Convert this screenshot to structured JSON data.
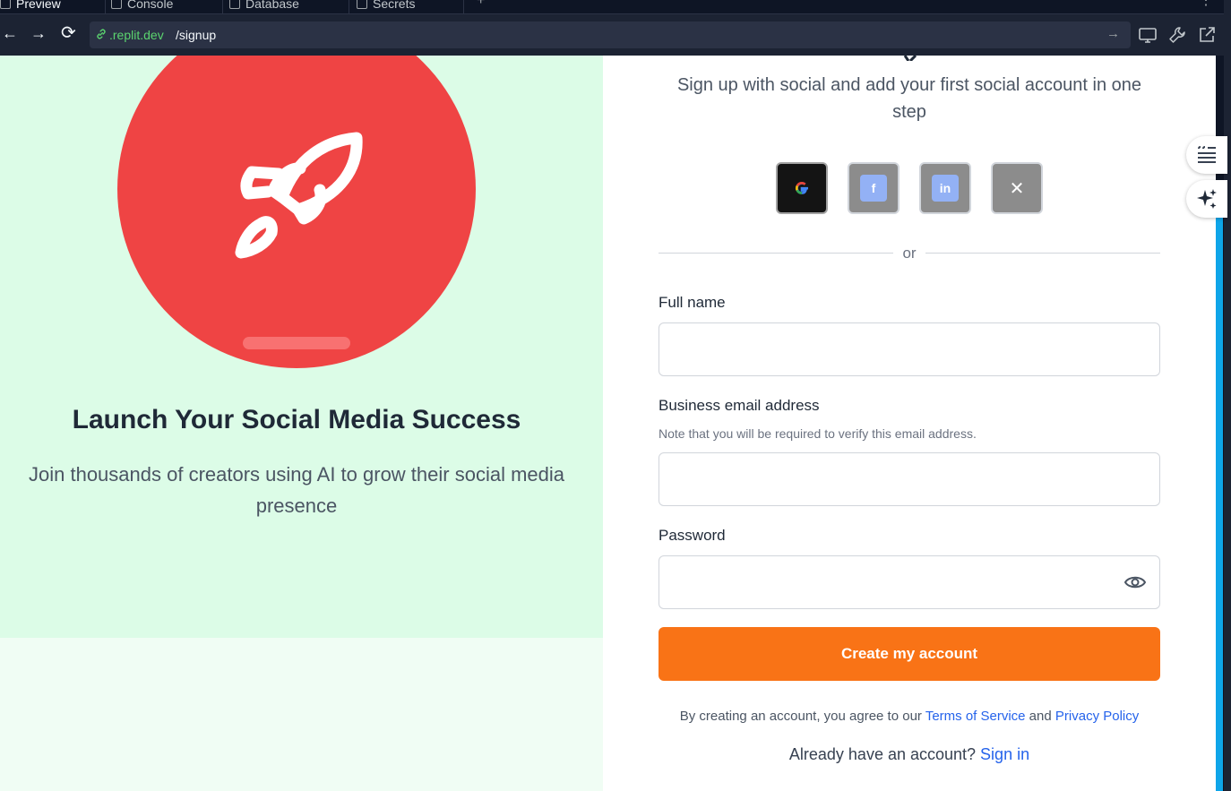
{
  "ide": {
    "tabs": [
      {
        "label": "Preview",
        "active": true
      },
      {
        "label": "Console",
        "active": false
      },
      {
        "label": "Database",
        "active": false
      },
      {
        "label": "Secrets",
        "active": false
      }
    ],
    "add_tab_glyph": "+",
    "more_glyph": "⋮"
  },
  "browser": {
    "back_glyph": "←",
    "forward_glyph": "→",
    "reload_glyph": "⟳",
    "url_host": ".replit.dev",
    "url_path": "/signup",
    "go_glyph": "→",
    "tool_icons": [
      "monitor-icon",
      "wrench-icon",
      "external-link-icon"
    ]
  },
  "hero": {
    "icon": "rocket-icon",
    "title": "Launch Your Social Media Success",
    "subtitle": "Join thousands of creators using AI to grow their social media presence",
    "accent": "#ef4444",
    "background": "#dcfce7"
  },
  "signup": {
    "subtitle": "Sign up with social and add your first social account in one step",
    "social_buttons": [
      {
        "name": "google",
        "glyph": "G"
      },
      {
        "name": "facebook",
        "glyph": "f"
      },
      {
        "name": "linkedin",
        "glyph": "in"
      },
      {
        "name": "x",
        "glyph": "✕"
      }
    ],
    "divider_text": "or",
    "full_name_label": "Full name",
    "email_label": "Business email address",
    "email_note": "Note that you will be required to verify this email address.",
    "password_label": "Password",
    "full_name_value": "",
    "email_value": "",
    "password_value": "",
    "create_button": "Create my account",
    "terms_prefix": "By creating an account, you agree to our ",
    "terms_link": "Terms of Service",
    "terms_and": " and ",
    "privacy_link": "Privacy Policy",
    "signin_prefix": "Already have an account? ",
    "signin_link": "Sign in",
    "cta_color": "#f97316",
    "link_color": "#2563eb"
  },
  "side_widgets": [
    "quote-list-icon",
    "sparkles-icon"
  ]
}
